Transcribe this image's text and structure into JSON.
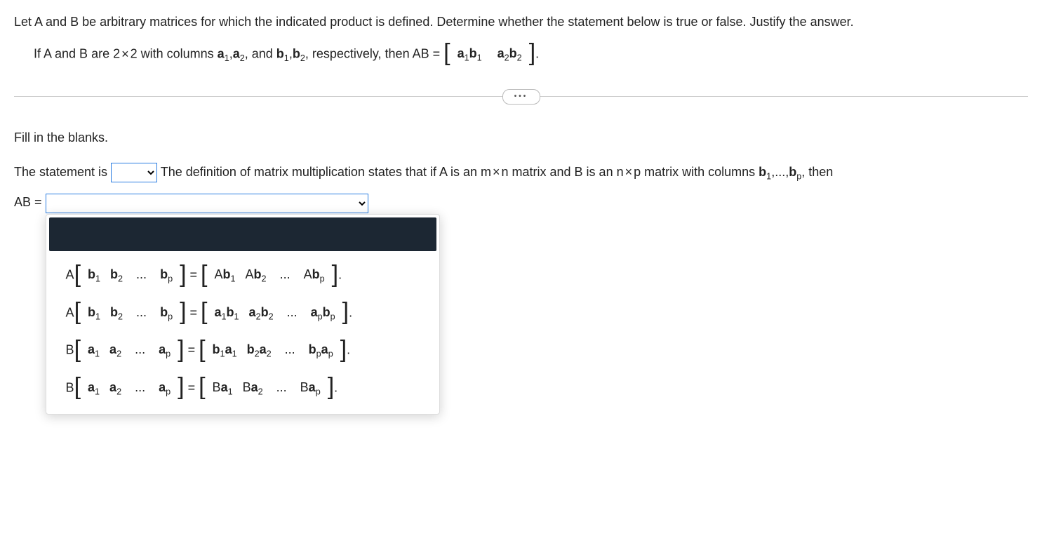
{
  "question": {
    "intro": "Let A and B be arbitrary matrices for which the indicated product is defined. Determine whether the statement below is true or false. Justify the answer.",
    "statement_prefix": "If A and B are 2",
    "times": "×",
    "statement_mid1": "2 with columns ",
    "a1": "a",
    "s1": "1",
    "comma1": ",",
    "a2": "a",
    "s2": "2",
    "statement_mid2": ", and ",
    "b1": "b",
    "sb1": "1",
    "comma2": ",",
    "b2": "b",
    "sb2": "2",
    "statement_mid3": ", respectively, then AB =",
    "mat_a1b1_a": "a",
    "mat_a1b1_as": "1",
    "mat_a1b1_b": "b",
    "mat_a1b1_bs": "1",
    "mat_a2b2_a": "a",
    "mat_a2b2_as": "2",
    "mat_a2b2_b": "b",
    "mat_a2b2_bs": "2",
    "period": "."
  },
  "fill_heading": "Fill in the blanks.",
  "sentence": {
    "p1": "The statement is",
    "p2": "The definition of matrix multiplication states that if A is an m",
    "p3": "n matrix and B is an n",
    "p4": "p matrix with columns ",
    "b1": "b",
    "bs1": "1",
    "dots": ",...,",
    "bp": "b",
    "bsp": "p",
    "p5": ", then",
    "ab_eq": "AB ="
  },
  "options": {
    "o1": {
      "lead": "A",
      "lhs": [
        "b|1",
        "b|2",
        "...",
        "b|p"
      ],
      "eq": "=",
      "rhs": [
        "Ab|1",
        "Ab|2",
        "...",
        "Ab|p"
      ],
      "tail": "."
    },
    "o2": {
      "lead": "A",
      "lhs": [
        "b|1",
        "b|2",
        "...",
        "b|p"
      ],
      "eq": "=",
      "rhs": [
        "a|1|b|1",
        "a|2|b|2",
        "...",
        "a|p|b|p"
      ],
      "tail": "."
    },
    "o3": {
      "lead": "B",
      "lhs": [
        "a|1",
        "a|2",
        "...",
        "a|p"
      ],
      "eq": "=",
      "rhs": [
        "b|1|a|1",
        "b|2|a|2",
        "...",
        "b|p|a|p"
      ],
      "tail": "."
    },
    "o4": {
      "lead": "B",
      "lhs": [
        "a|1",
        "a|2",
        "...",
        "a|p"
      ],
      "eq": "=",
      "rhs": [
        "Ba|1",
        "Ba|2",
        "...",
        "Ba|p"
      ],
      "tail": "."
    }
  }
}
